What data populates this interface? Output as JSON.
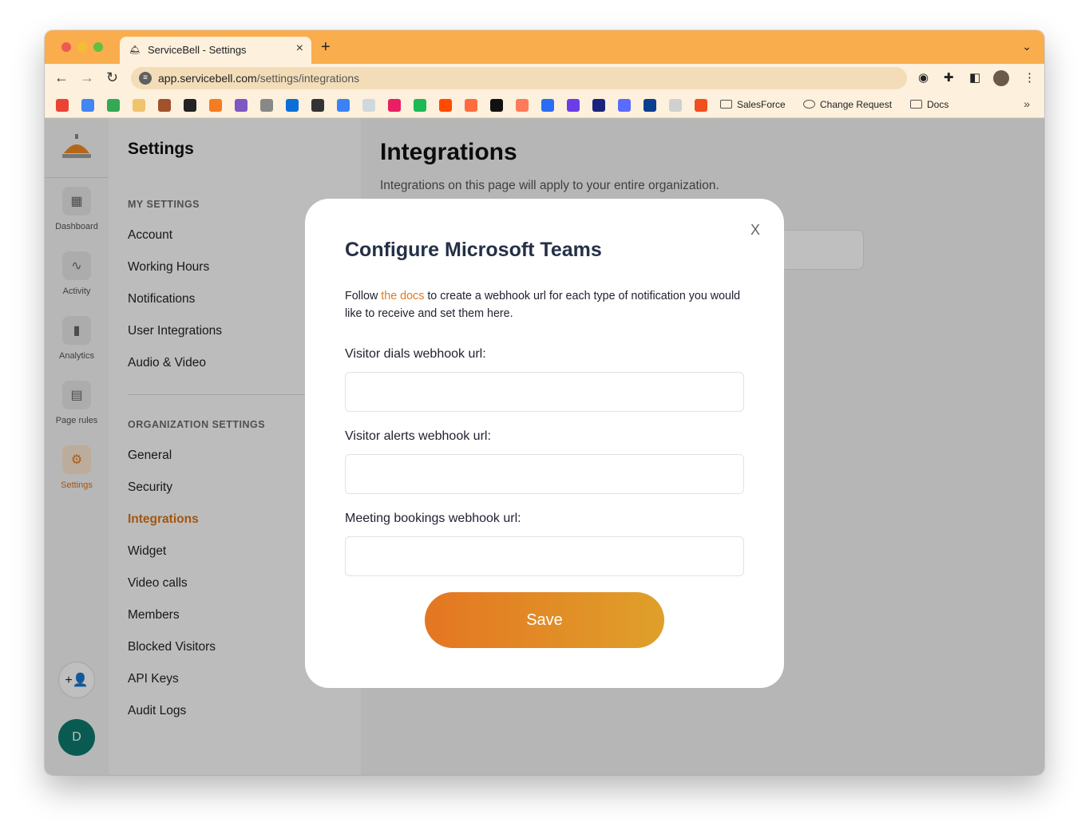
{
  "browser": {
    "tab_title": "ServiceBell - Settings",
    "tab_close": "×",
    "new_tab": "+",
    "tab_list": "⌄",
    "url_host": "app.servicebell.com",
    "url_path": "/settings/integrations",
    "bookmarks": {
      "folder1": "SalesForce",
      "folder2": "Change Request",
      "folder3": "Docs",
      "more": "»"
    }
  },
  "rail": {
    "items": [
      {
        "label": "Dashboard",
        "icon": "dashboard-icon"
      },
      {
        "label": "Activity",
        "icon": "activity-icon"
      },
      {
        "label": "Analytics",
        "icon": "analytics-icon"
      },
      {
        "label": "Page rules",
        "icon": "page-rules-icon"
      },
      {
        "label": "Settings",
        "icon": "gear-icon"
      }
    ],
    "user_initial": "D"
  },
  "settings": {
    "title": "Settings",
    "my_settings_heading": "MY SETTINGS",
    "my_settings": [
      "Account",
      "Working Hours",
      "Notifications",
      "User Integrations",
      "Audio & Video"
    ],
    "org_settings_heading": "ORGANIZATION SETTINGS",
    "org_settings": [
      "General",
      "Security",
      "Integrations",
      "Widget",
      "Video calls",
      "Members",
      "Blocked Visitors",
      "API Keys",
      "Audit Logs"
    ]
  },
  "main": {
    "title": "Integrations",
    "subtitle": "Integrations on this page will apply to your entire organization."
  },
  "modal": {
    "title": "Configure Microsoft Teams",
    "close": "X",
    "desc_before": "Follow ",
    "desc_link": "the docs",
    "desc_after": " to create a webhook url for each type of notification you would like to receive and set them here.",
    "fields": [
      {
        "label": "Visitor dials webhook url:",
        "value": "",
        "placeholder": ""
      },
      {
        "label": "Visitor alerts webhook url:",
        "value": "",
        "placeholder": ""
      },
      {
        "label": "Meeting bookings webhook url:",
        "value": "",
        "placeholder": ""
      }
    ],
    "save_label": "Save"
  },
  "colors": {
    "chrome_tabstrip": "#f9ad4d",
    "accent": "#d77317",
    "save_start": "#e47622",
    "save_end": "#dfa02a",
    "avatar": "#0d7a6c"
  }
}
